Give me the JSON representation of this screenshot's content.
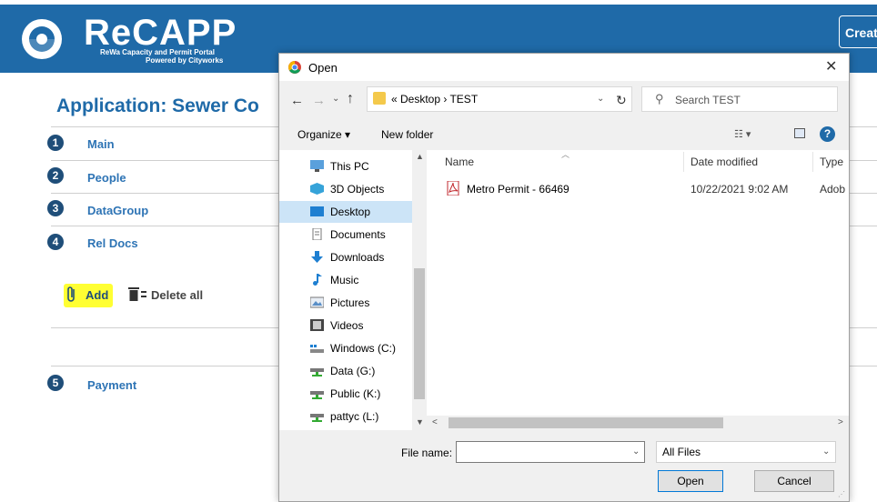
{
  "header": {
    "logo_title": "ReCAPP",
    "logo_sub1": "ReWa Capacity and Permit Portal",
    "logo_sub2": "Powered by Cityworks",
    "create_label": "Creat"
  },
  "page": {
    "title": "Application: Sewer Co",
    "steps": [
      {
        "num": "1",
        "label": "Main"
      },
      {
        "num": "2",
        "label": "People"
      },
      {
        "num": "3",
        "label": "DataGroup"
      },
      {
        "num": "4",
        "label": "Rel Docs"
      },
      {
        "num": "5",
        "label": "Payment"
      }
    ],
    "add_label": "Add",
    "delete_all_label": "Delete all"
  },
  "dialog": {
    "title": "Open",
    "close_glyph": "✕",
    "address": "« Desktop › TEST",
    "search_placeholder": "Search TEST",
    "organize_label": "Organize ▾",
    "new_folder_label": "New folder",
    "nav_items": [
      {
        "label": "This PC",
        "icon": "pc-icon"
      },
      {
        "label": "3D Objects",
        "icon": "cube-icon"
      },
      {
        "label": "Desktop",
        "icon": "desktop-icon",
        "selected": true
      },
      {
        "label": "Documents",
        "icon": "document-icon"
      },
      {
        "label": "Downloads",
        "icon": "download-icon"
      },
      {
        "label": "Music",
        "icon": "music-icon"
      },
      {
        "label": "Pictures",
        "icon": "picture-icon"
      },
      {
        "label": "Videos",
        "icon": "video-icon"
      },
      {
        "label": "Windows (C:)",
        "icon": "drive-icon"
      },
      {
        "label": "Data (G:)",
        "icon": "network-drive-icon"
      },
      {
        "label": "Public (K:)",
        "icon": "network-drive-icon"
      },
      {
        "label": "pattyc (L:)",
        "icon": "network-drive-icon"
      }
    ],
    "columns": {
      "name": "Name",
      "date": "Date modified",
      "type": "Type"
    },
    "files": [
      {
        "name": "Metro Permit - 66469",
        "date": "10/22/2021 9:02 AM",
        "type": "Adob"
      }
    ],
    "file_name_label": "File name:",
    "file_name_value": "",
    "file_type_value": "All Files",
    "open_label": "Open",
    "cancel_label": "Cancel"
  },
  "colors": {
    "brand": "#1f6aa8",
    "highlight": "#ffff33",
    "selection": "#cce4f7"
  }
}
